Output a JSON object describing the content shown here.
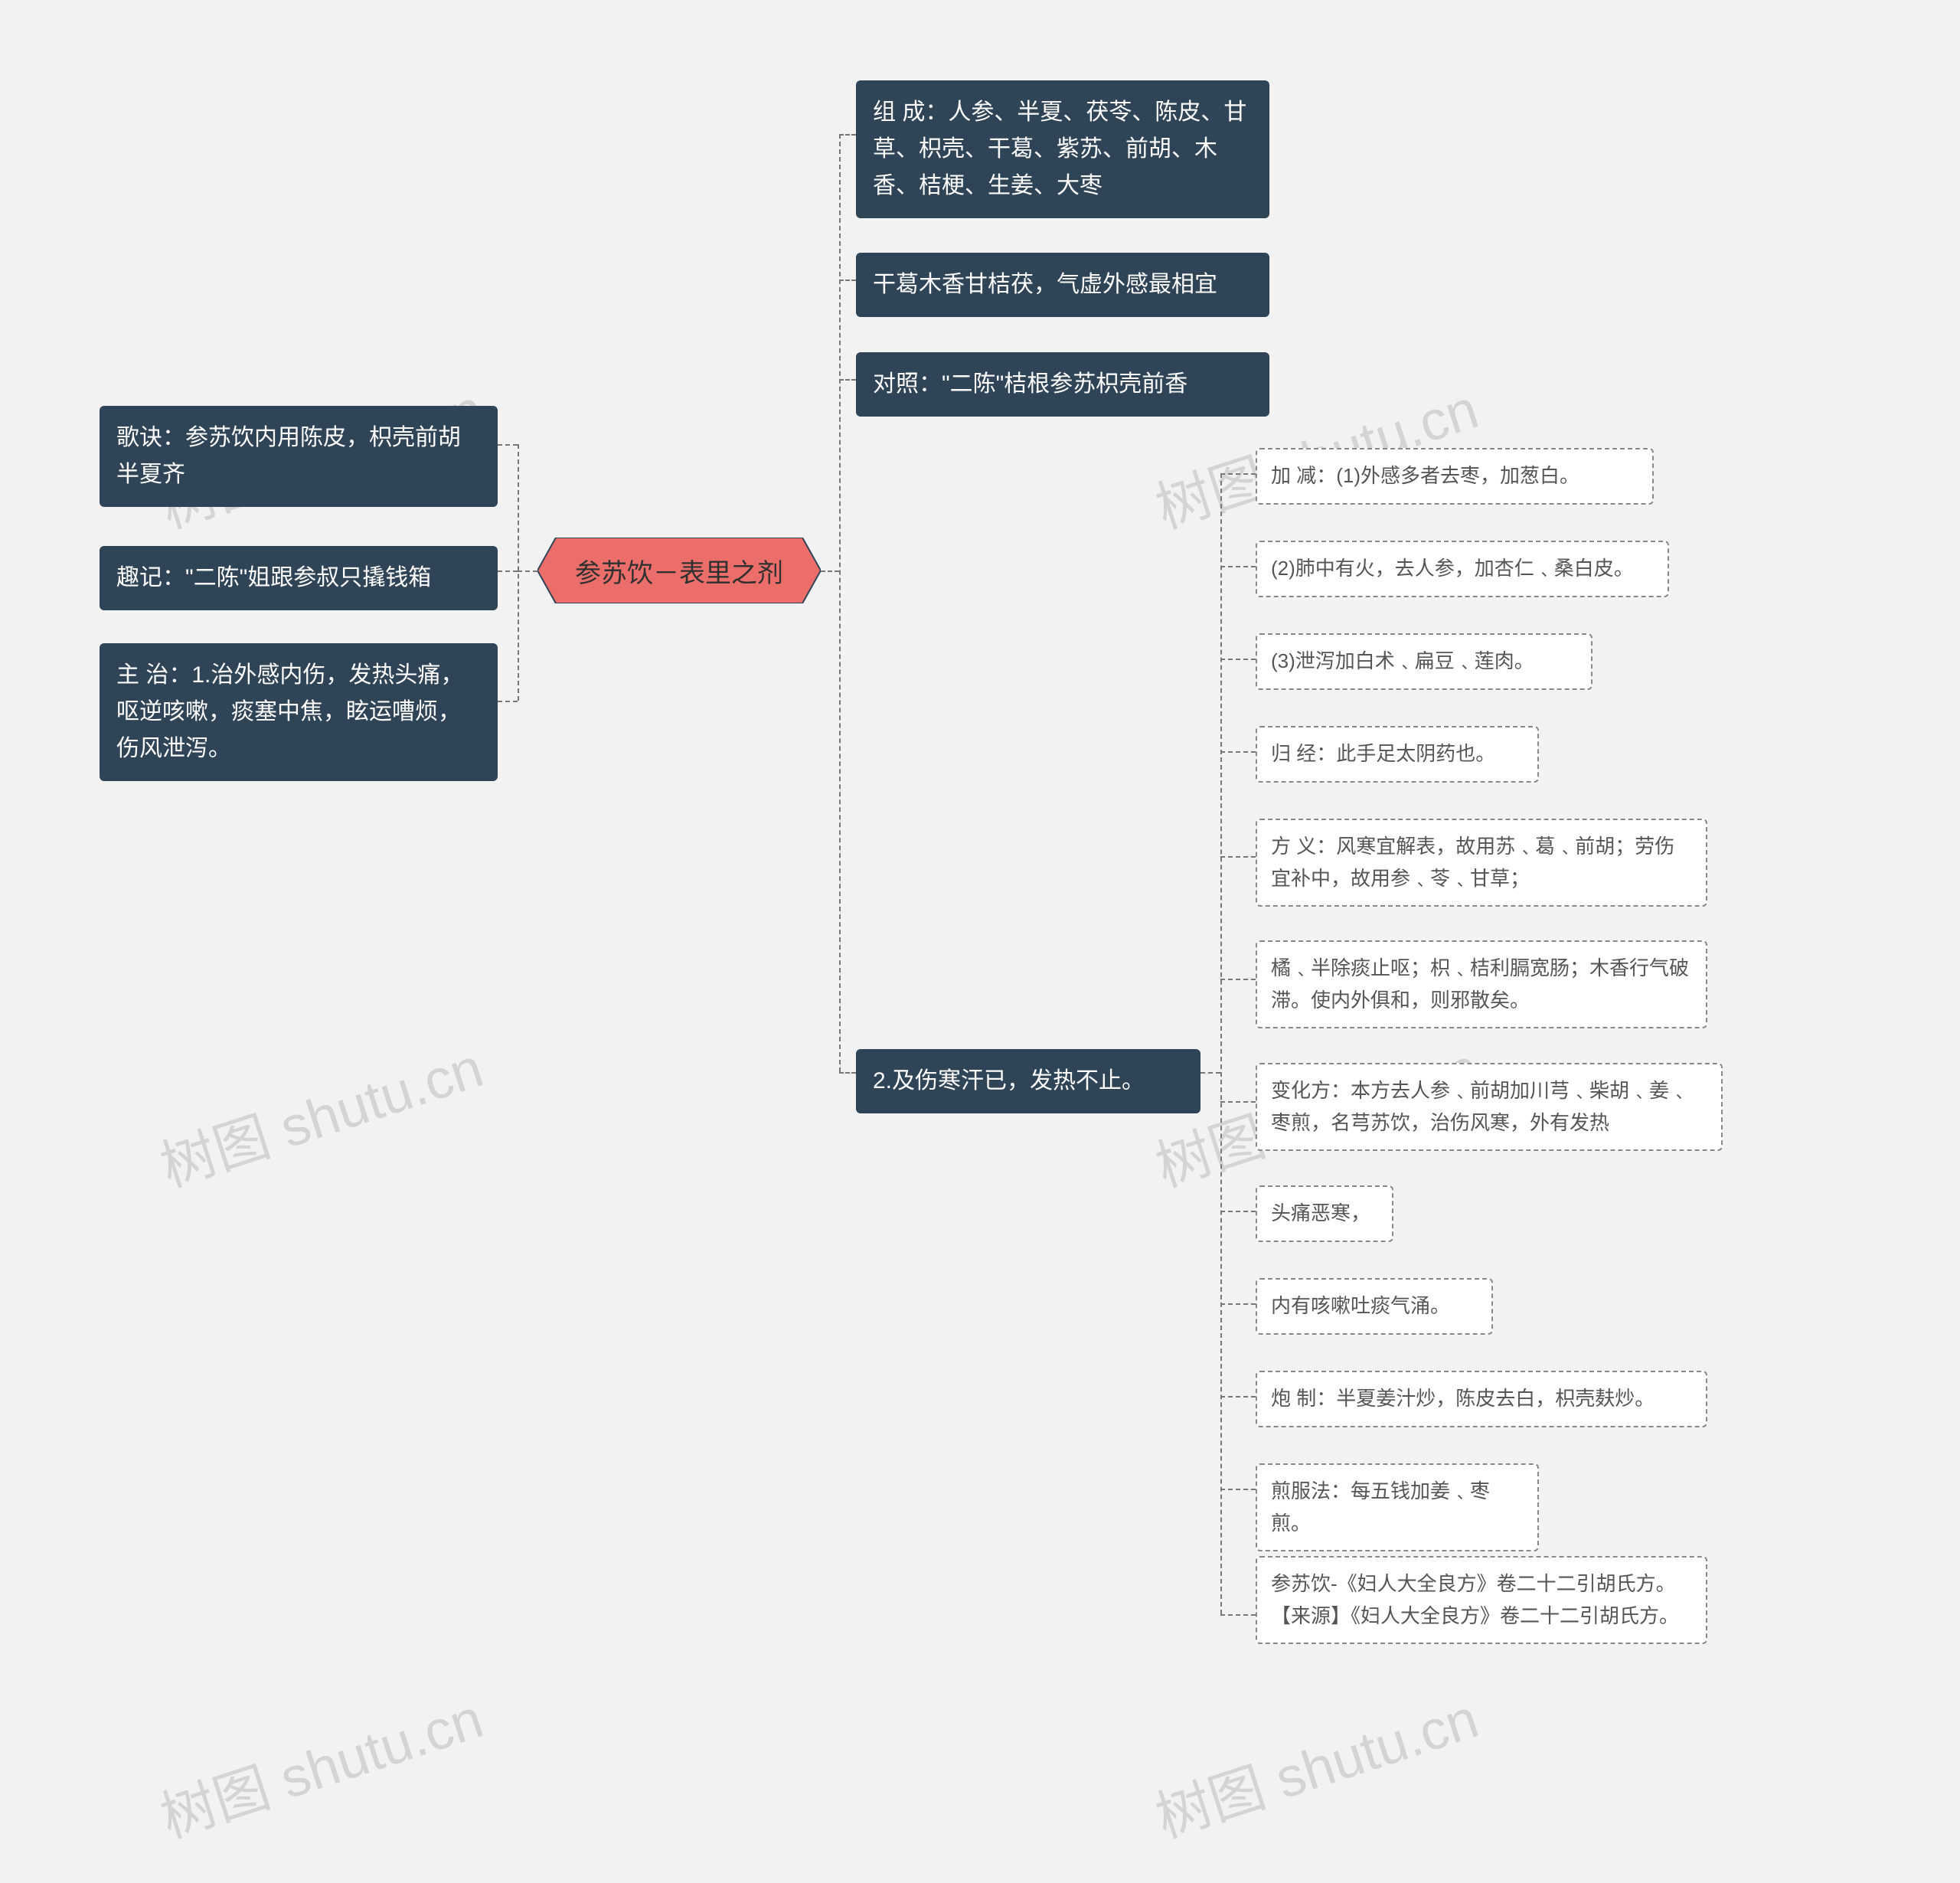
{
  "center": {
    "label": "参苏饮－表里之剂"
  },
  "left": {
    "n1": "歌诀：参苏饮内用陈皮，枳壳前胡半夏齐",
    "n2": "趣记：\"二陈\"姐跟参叔只撬钱箱",
    "n3": "主 治：1.治外感内伤，发热头痛，呕逆咳嗽，痰塞中焦，眩运嘈烦，伤风泄泻。"
  },
  "right": {
    "n1": "组 成：人参、半夏、茯苓、陈皮、甘草、枳壳、干葛、紫苏、前胡、木香、桔梗、生姜、大枣",
    "n2": "干葛木香甘桔茯，气虚外感最相宜",
    "n3": "对照：\"二陈\"桔根参苏枳壳前香",
    "n4": "2.及伤寒汗已，发热不止。"
  },
  "details": {
    "d1": "加 减：(1)外感多者去枣，加葱白。",
    "d2": "(2)肺中有火，去人参，加杏仁﹑桑白皮。",
    "d3": "(3)泄泻加白术﹑扁豆﹑莲肉。",
    "d4": "归 经：此手足太阴药也。",
    "d5": "方 义：风寒宜解表，故用苏﹑葛﹑前胡；劳伤宜补中，故用参﹑苓﹑甘草；",
    "d6": "橘﹑半除痰止呕；枳﹑桔利膈宽肠；木香行气破滞。使内外俱和，则邪散矣。",
    "d7": "变化方：本方去人参﹑前胡加川芎﹑柴胡﹑姜﹑枣煎，名芎苏饮，治伤风寒，外有发热",
    "d8": "头痛恶寒，",
    "d9": "内有咳嗽吐痰气涌。",
    "d10": "炮 制：半夏姜汁炒，陈皮去白，枳壳麸炒。",
    "d11": "煎服法：每五钱加姜﹑枣煎。",
    "d12": "参苏饮-《妇人大全良方》卷二十二引胡氏方。【来源】《妇人大全良方》卷二十二引胡氏方。"
  },
  "watermark": "树图 shutu.cn"
}
